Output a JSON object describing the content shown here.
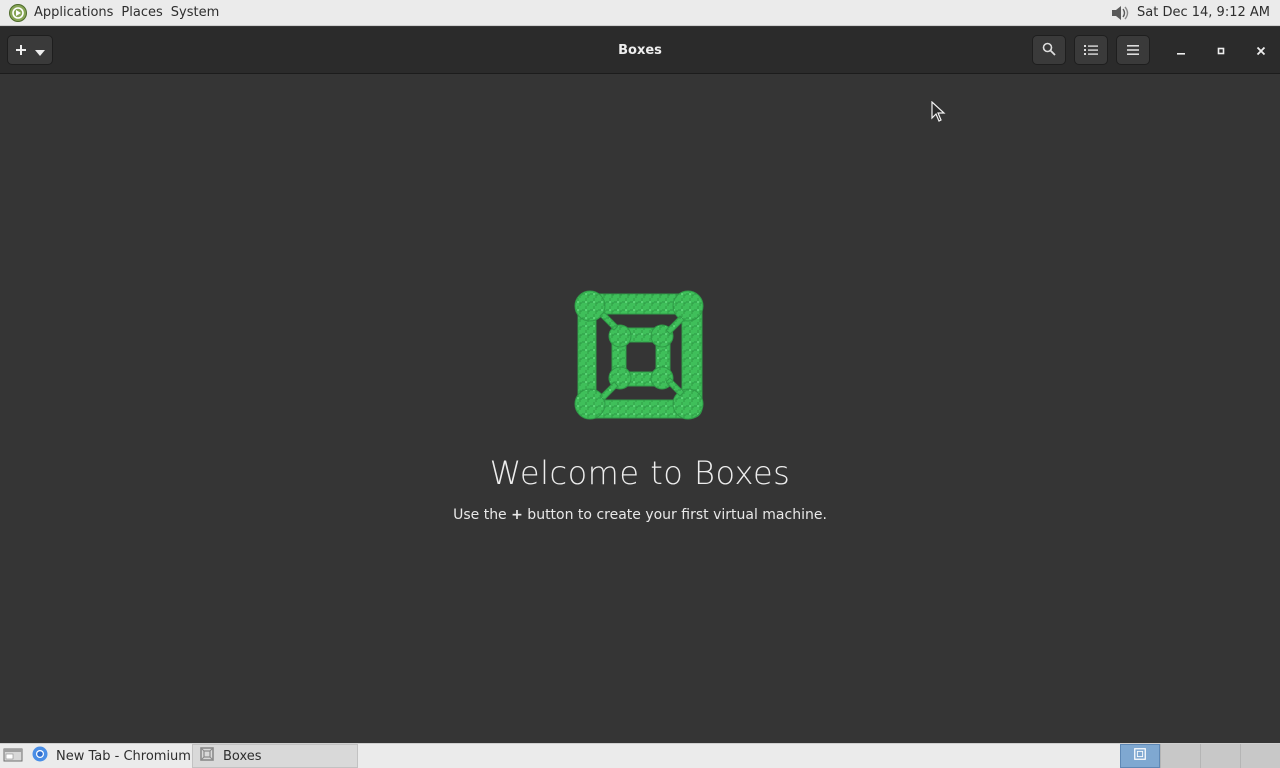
{
  "top_panel": {
    "menus": [
      "Applications",
      "Places",
      "System"
    ],
    "clock": "Sat Dec 14,  9:12 AM",
    "icons": {
      "app_logo": "mate-logo-icon",
      "volume": "volume-icon"
    }
  },
  "headerbar": {
    "title": "Boxes",
    "new_button_icons": [
      "plus-icon",
      "chevron-down-icon"
    ],
    "right_icons": [
      "search-icon",
      "list-view-icon",
      "hamburger-menu-icon"
    ],
    "window_controls": [
      "minimize-icon",
      "maximize-icon",
      "close-icon"
    ]
  },
  "welcome": {
    "title": "Welcome to Boxes",
    "subtitle_prefix": "Use the ",
    "subtitle_bold": "+",
    "subtitle_suffix": " button to create your first virtual machine.",
    "logo_color": "#3fbf5a"
  },
  "taskbar": {
    "tasks": [
      {
        "label": "New Tab - Chromium",
        "icon": "chromium-icon"
      },
      {
        "label": "Boxes",
        "icon": "boxes-icon"
      }
    ],
    "workspaces": 4,
    "active_workspace": 1
  },
  "colors": {
    "window_bg": "#353535",
    "headerbar_bg": "#2b2b2b",
    "panel_bg": "#ebebeb",
    "accent_green": "#3fbf5a"
  }
}
